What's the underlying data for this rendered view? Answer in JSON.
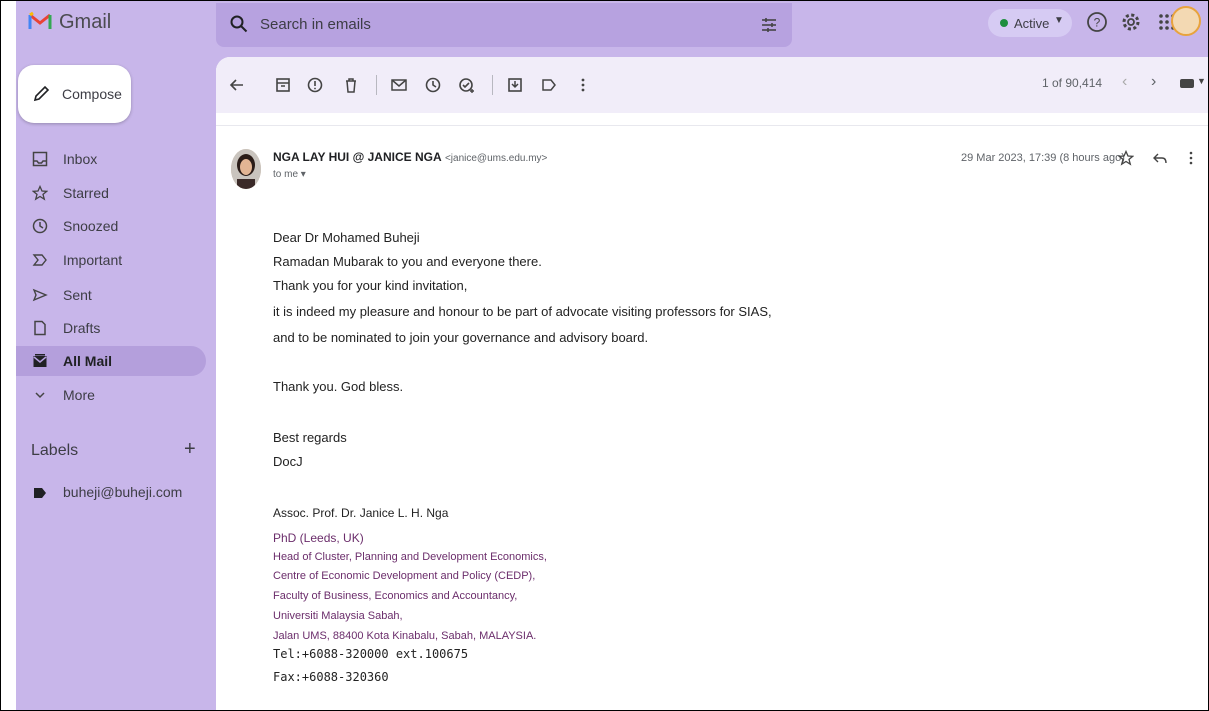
{
  "app": {
    "name": "Gmail"
  },
  "search": {
    "placeholder": "Search in emails"
  },
  "status": {
    "label": "Active"
  },
  "compose": {
    "label": "Compose"
  },
  "nav": [
    {
      "label": "Inbox",
      "icon": "inbox-icon"
    },
    {
      "label": "Starred",
      "icon": "star-icon"
    },
    {
      "label": "Snoozed",
      "icon": "clock-icon"
    },
    {
      "label": "Important",
      "icon": "important-icon"
    },
    {
      "label": "Sent",
      "icon": "send-icon"
    },
    {
      "label": "Drafts",
      "icon": "draft-icon"
    },
    {
      "label": "All Mail",
      "icon": "all-mail-icon",
      "active": true
    },
    {
      "label": "More",
      "icon": "chevron-down-icon"
    }
  ],
  "labels": {
    "title": "Labels",
    "add": "+",
    "items": [
      {
        "label": "buheji@buheji.com"
      }
    ]
  },
  "toolbar": {
    "count": "1 of 90,414",
    "prev": "‹",
    "next": "›"
  },
  "message": {
    "sender_name": "NGA LAY HUI @ JANICE NGA",
    "sender_email": "<janice@ums.edu.my>",
    "to": "to me ▾",
    "timestamp": "29 Mar 2023, 17:39 (8 hours ago)",
    "body": [
      "Dear Dr Mohamed Buheji",
      "Ramadan Mubarak to you and everyone there.",
      "Thank you for your kind invitation,",
      "it is indeed my pleasure and honour to be part of advocate visiting professors for SIAS,",
      "and to be nominated to join your governance and advisory board.",
      "Thank you. God bless.",
      "Best regards",
      "DocJ"
    ],
    "signature": [
      "Assoc. Prof. Dr. Janice L. H. Nga",
      "PhD (Leeds, UK)",
      "Head of Cluster, Planning and Development Economics,",
      "Centre of Economic Development and Policy (CEDP),",
      "Faculty of Business, Economics and Accountancy,",
      "Universiti Malaysia Sabah,",
      "Jalan UMS, 88400 Kota Kinabalu, Sabah, MALAYSIA.",
      "Tel:+6088-320000 ext.100675",
      "Fax:+6088-320360"
    ]
  },
  "colors": {
    "sidebar_bg": "#c8b6ea",
    "active_nav": "#b49fdc",
    "signature_text": "#6b2d6b"
  }
}
